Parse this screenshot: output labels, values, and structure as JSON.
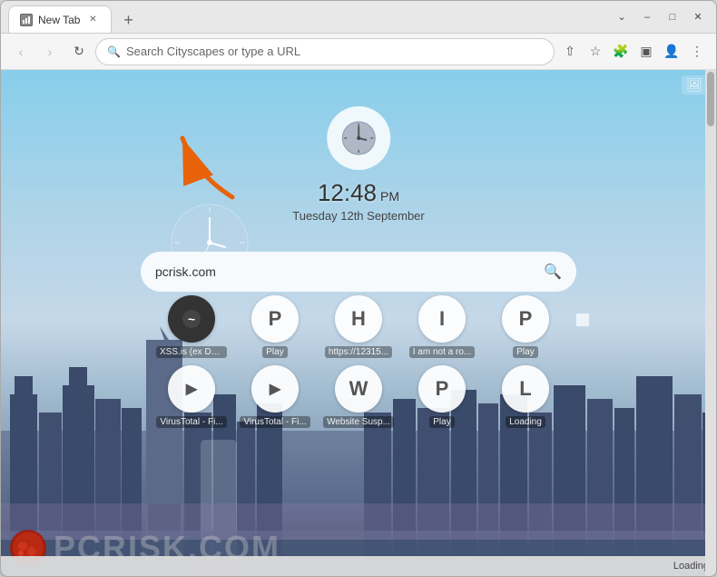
{
  "browser": {
    "tab": {
      "title": "New Tab",
      "favicon": "🌐"
    },
    "new_tab_btn": "+",
    "window_controls": {
      "minimize": "–",
      "maximize": "□",
      "close": "✕"
    },
    "nav": {
      "back_disabled": true,
      "forward_disabled": true,
      "refresh": "↻",
      "address_placeholder": "Search Cityscapes or type a URL"
    },
    "nav_right_icons": [
      "share",
      "star",
      "extension",
      "sidebar",
      "profile",
      "menu"
    ]
  },
  "new_tab": {
    "clock": {
      "time": "12:48",
      "ampm": "PM",
      "date": "Tuesday 12th September"
    },
    "search": {
      "value": "pcrisk.com",
      "placeholder": "Search Cityscapes or type a URL"
    },
    "speed_dial_row1": [
      {
        "label": "XSS.is (ex Da...",
        "icon": "~",
        "dark": true
      },
      {
        "label": "Play",
        "icon": "P",
        "dark": false
      },
      {
        "label": "https://12315...",
        "icon": "H",
        "dark": false
      },
      {
        "label": "I am not a ro...",
        "icon": "I",
        "dark": false
      },
      {
        "label": "Play",
        "icon": "P",
        "dark": false
      }
    ],
    "speed_dial_row2": [
      {
        "label": "VirusTotal - Fi...",
        "icon": "▶",
        "dark": false
      },
      {
        "label": "VirusTotal - Fi...",
        "icon": "▶",
        "dark": false
      },
      {
        "label": "Website Susp...",
        "icon": "W",
        "dark": false
      },
      {
        "label": "Play",
        "icon": "P",
        "dark": false
      },
      {
        "label": "Loading",
        "icon": "L",
        "dark": false
      }
    ],
    "watermark": "PCrisk.com",
    "loading_text": "Loading"
  },
  "icons": {
    "search": "🔍",
    "star": "☆",
    "share": "⇧",
    "extension": "🧩",
    "sidebar": "▣",
    "profile": "👤",
    "menu": "⋮",
    "image": "🖼",
    "clock": "🕐"
  },
  "colors": {
    "accent_orange": "#E8620A",
    "tab_bg": "#ffffff",
    "browser_chrome": "#e8e8e8",
    "address_bg": "#ffffff"
  }
}
